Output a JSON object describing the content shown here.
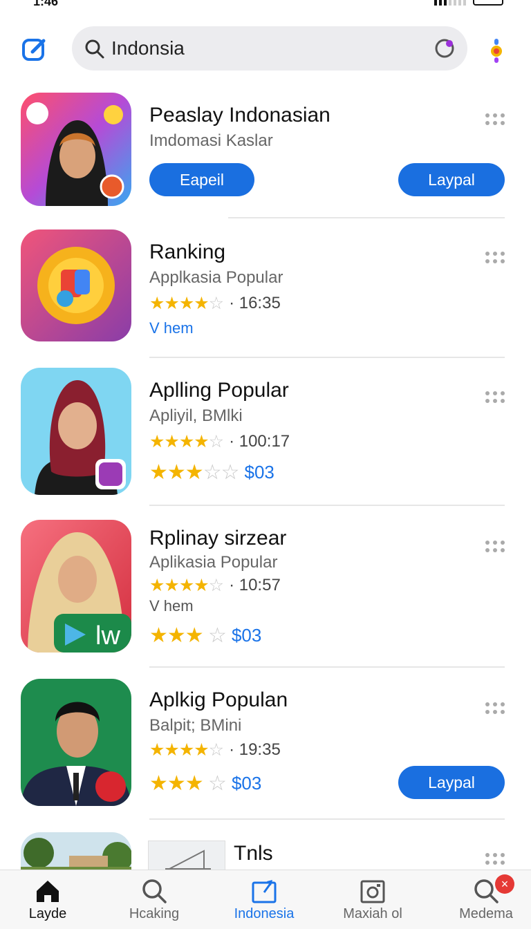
{
  "status": {
    "time": "1:46"
  },
  "search": {
    "query": "Indonsia"
  },
  "apps": [
    {
      "title": "Peaslay Indonasian",
      "subtitle": "Imdomasi Kaslar",
      "button_left": "Eapeil",
      "button_right": "Laypal"
    },
    {
      "title": "Ranking",
      "subtitle": "Applkasia Popular",
      "stars": "★★★★",
      "stars_empty": "☆",
      "rating": "· 16:35",
      "link": "V hem"
    },
    {
      "title": "Aplling Popular",
      "subtitle": "Apliyil,  BMlki",
      "stars": "★★★★",
      "stars_empty": "☆",
      "rating": "· 100:17",
      "stars2": "★★★",
      "stars2_empty": "☆☆",
      "price": "$03"
    },
    {
      "title": "Rplinay sirzear",
      "subtitle": "Aplikasia Popular",
      "stars": "★★★★",
      "stars_empty": "☆",
      "rating": "· 10:57",
      "extra": "V hem",
      "stars2": "★★★",
      "stars2_empty": "☆",
      "price": "$03",
      "icon_text": "lw"
    },
    {
      "title": "Aplkig Populan",
      "subtitle": "Balpit;  BMini",
      "stars": "★★★★",
      "stars_empty": "☆",
      "rating": "· 19:35",
      "stars2": "★★★",
      "stars2_empty": "☆",
      "price": "$03",
      "button_right": "Laypal"
    },
    {
      "title": "Tnls"
    }
  ],
  "nav": [
    {
      "label": "Layde",
      "icon": "home-icon"
    },
    {
      "label": "Hcaking",
      "icon": "search-icon"
    },
    {
      "label": "Indonesia",
      "icon": "share-icon"
    },
    {
      "label": "Maxiah ol",
      "icon": "camera-icon"
    },
    {
      "label": "Medema",
      "icon": "search-icon",
      "badge": "×"
    }
  ],
  "colors": {
    "accent": "#1a6fe0",
    "star": "#f4b400",
    "link": "#1a73e8"
  }
}
